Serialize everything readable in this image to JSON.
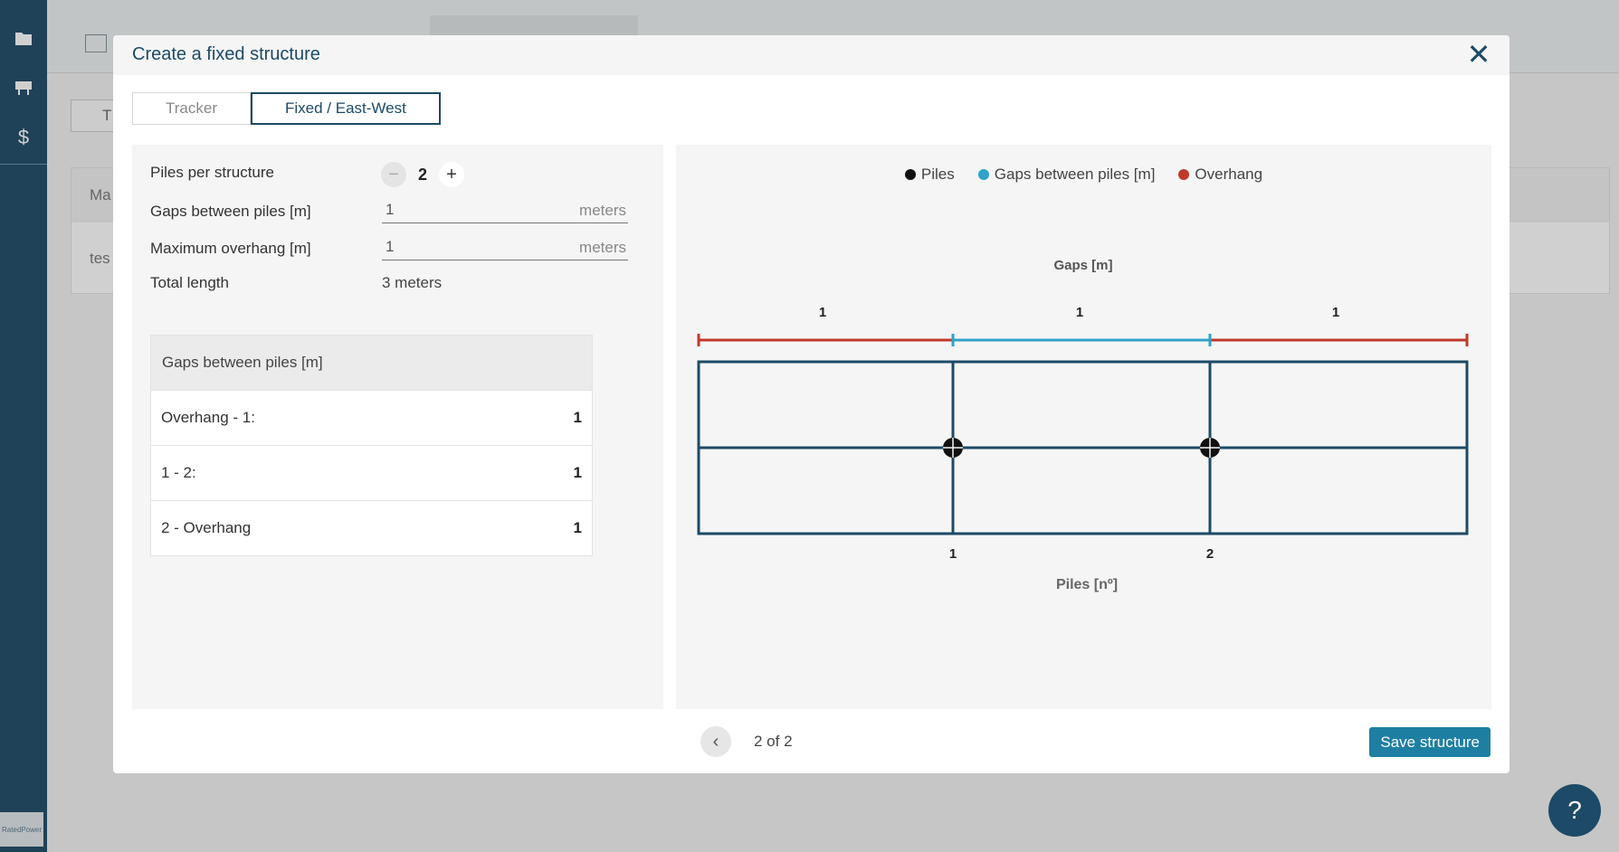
{
  "background": {
    "sidebar_icons": [
      "folder-icon",
      "desk-icon",
      "dollar-icon"
    ],
    "row_label_1": "Ma",
    "row_label_2": "tes",
    "tab_fragment": "T",
    "help_label": "?",
    "logo_text": "RatedPower"
  },
  "modal": {
    "title": "Create a fixed structure",
    "close_label": "✕",
    "tabs": [
      {
        "label": "Tracker",
        "active": false
      },
      {
        "label": "Fixed / East-West",
        "active": true
      }
    ],
    "form": {
      "piles_label": "Piles per structure",
      "piles_value": "2",
      "minus_label": "−",
      "plus_label": "+",
      "gaps_label": "Gaps between piles [m]",
      "gaps_value": "1",
      "gaps_unit": "meters",
      "overhang_label": "Maximum overhang [m]",
      "overhang_value": "1",
      "overhang_unit": "meters",
      "total_label": "Total length",
      "total_value": "3 meters"
    },
    "gaps_table": {
      "header": "Gaps between piles [m]",
      "rows": [
        {
          "label": "Overhang - 1:",
          "value": "1"
        },
        {
          "label": "1 - 2:",
          "value": "1"
        },
        {
          "label": "2 - Overhang",
          "value": "1"
        }
      ]
    },
    "diagram": {
      "legend": [
        {
          "label": "Piles",
          "color": "#111111"
        },
        {
          "label": "Gaps between piles [m]",
          "color": "#2fa3c9"
        },
        {
          "label": "Overhang",
          "color": "#c0392b"
        }
      ],
      "top_title": "Gaps [m]",
      "segment_labels": [
        "1",
        "1",
        "1"
      ],
      "pile_labels": [
        "1",
        "2"
      ],
      "bottom_title": "Piles [nº]",
      "colors": {
        "frame": "#1d4a66",
        "gap": "#2fa3c9",
        "overhang": "#c0392b",
        "pile": "#111111"
      }
    },
    "pager": {
      "prev_label": "‹",
      "text": "2 of 2"
    },
    "save_label": "Save structure"
  }
}
